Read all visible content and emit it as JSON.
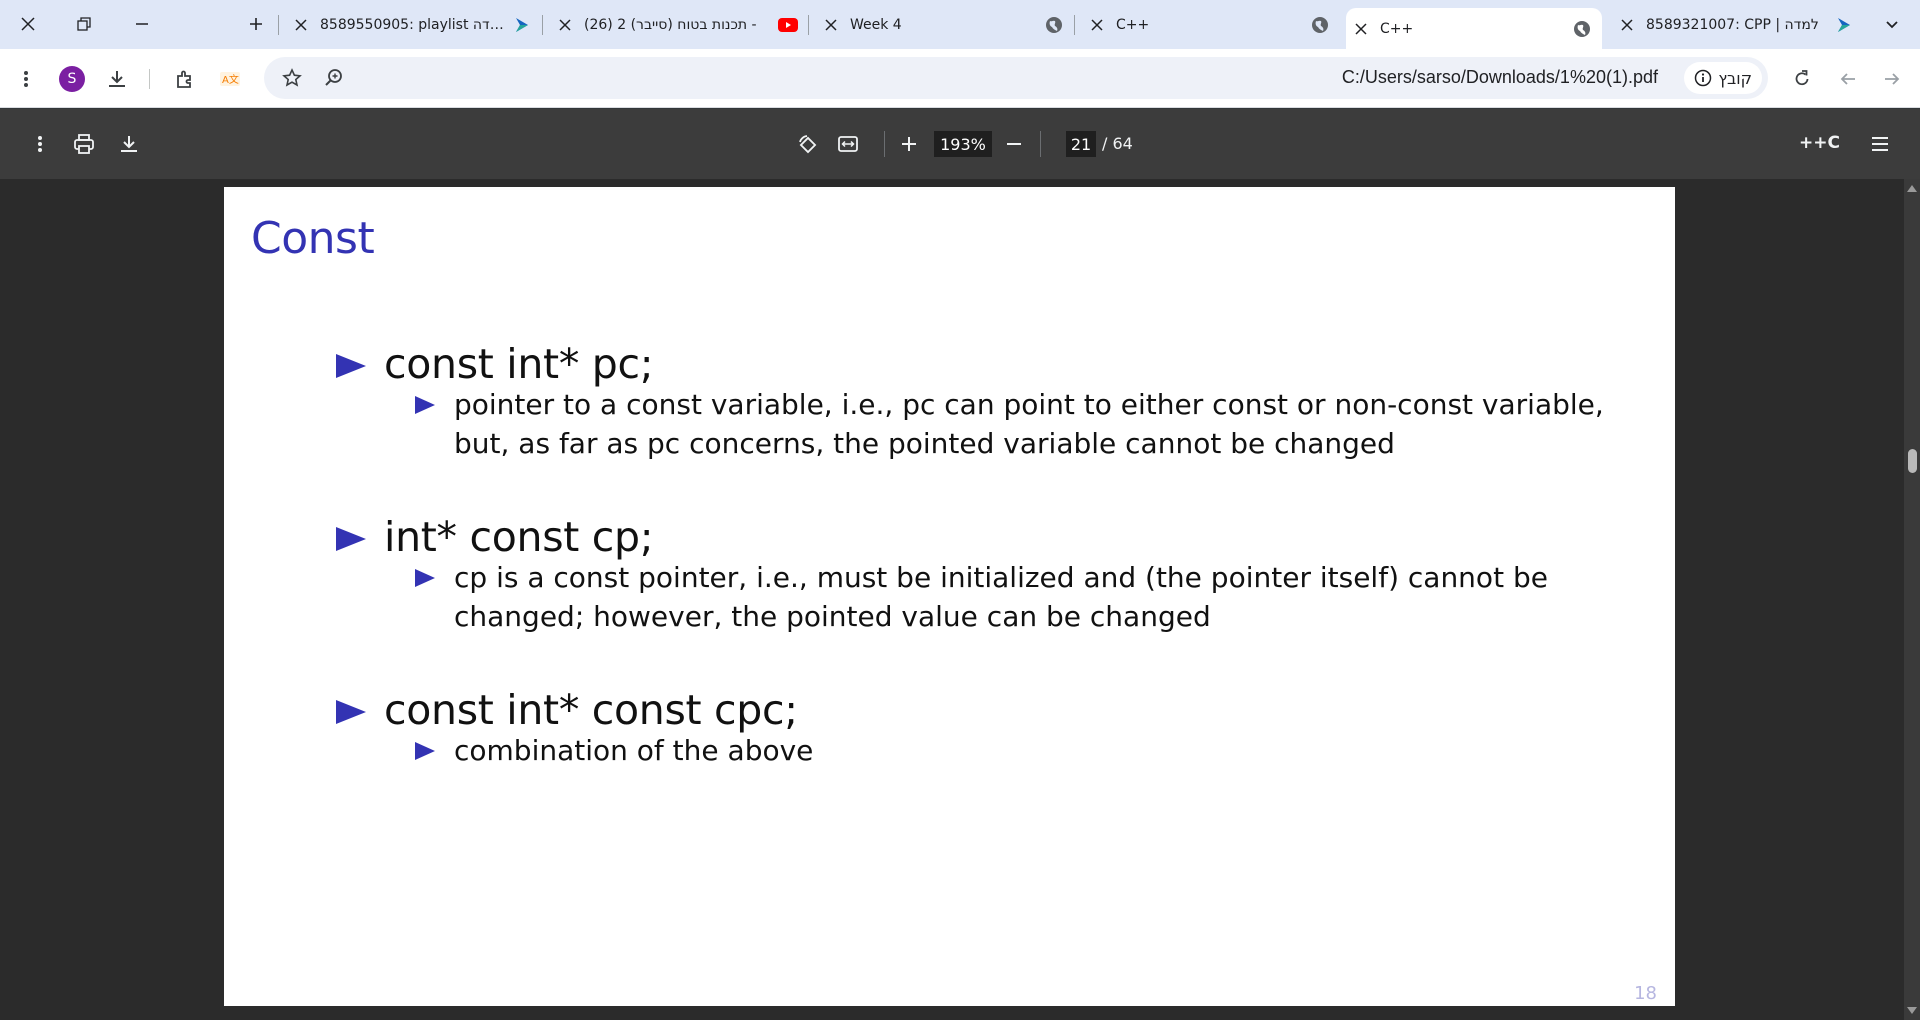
{
  "browser": {
    "tabs": [
      {
        "title": "8589550905: playlist למדה",
        "favicon": "lamda-icon",
        "active": false
      },
      {
        "title": "(26) תכנות בטוח (סייבר) 2 -",
        "favicon": "youtube-icon",
        "active": false
      },
      {
        "title": "Week 4",
        "favicon": "globe-icon",
        "active": false
      },
      {
        "title": "C++",
        "favicon": "globe-icon",
        "active": false
      },
      {
        "title": "C++",
        "favicon": "globe-icon",
        "active": true
      },
      {
        "title": "8589321007: CPP | למדה",
        "favicon": "lamda-icon",
        "active": false
      }
    ],
    "profile_initial": "S",
    "url": "C:/Users/sarso/Downloads/1%20(1).pdf",
    "site_chip": "קובץ"
  },
  "pdf": {
    "zoom": "193%",
    "page_current": "21",
    "page_total": "/ 64",
    "doc_title": "C++"
  },
  "slide": {
    "title": "Const",
    "items": [
      {
        "code": "const int* pc;",
        "desc": "pointer to a const variable, i.e., pc can point to either const or non-const variable, but, as far as pc concerns, the pointed variable cannot be changed"
      },
      {
        "code": "int* const cp;",
        "desc": "cp is a const pointer, i.e., must be initialized and (the pointer itself) cannot be changed; however, the pointed value can be changed"
      },
      {
        "code": "const int* const cpc;",
        "desc": "combination of the above"
      }
    ],
    "page_number": "18"
  },
  "colors": {
    "accent": "#3333b3",
    "pdf_toolbar": "#3c3c3c",
    "tabstrip": "#dfe7f7"
  }
}
